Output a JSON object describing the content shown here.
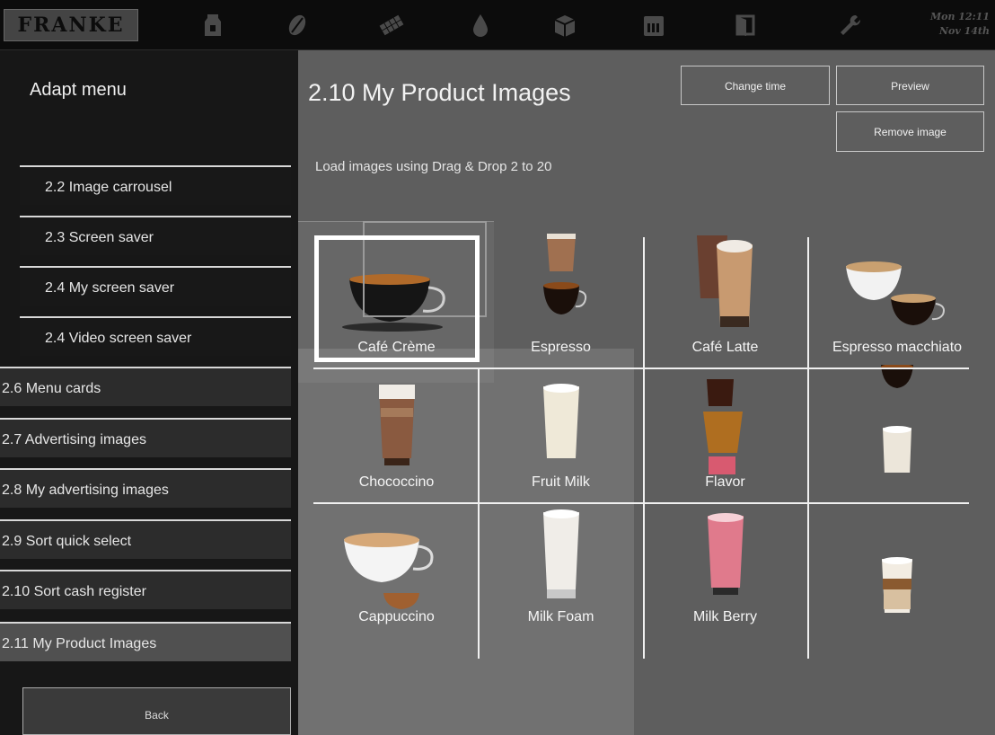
{
  "header": {
    "logo": "FRANKE",
    "icons": [
      "milk-carton-icon",
      "coffee-bean-icon",
      "chocolate-icon",
      "water-drop-icon",
      "box-icon",
      "brush-icon",
      "door-icon",
      "wrench-icon"
    ],
    "date_line1": "Mon 12:11",
    "date_line2": "Nov 14th"
  },
  "sidebar": {
    "title": "Adapt menu",
    "items": [
      {
        "label": "2.2 Image carrousel"
      },
      {
        "label": "2.3 Screen saver"
      },
      {
        "label": "2.4  My screen saver"
      },
      {
        "label": "2.4 Video screen saver"
      },
      {
        "label": "2.6 Menu cards"
      },
      {
        "label": "2.7 Advertising images"
      },
      {
        "label": "2.8 My advertising images"
      },
      {
        "label": "2.9 Sort quick select"
      },
      {
        "label": "2.10 Sort cash register"
      },
      {
        "label": "2.11 My Product Images"
      }
    ],
    "back_label": "Back"
  },
  "main": {
    "title": "2.10 My Product Images",
    "subtitle": "Load images using Drag & Drop 2 to 20",
    "buttons": {
      "change_time": "Change time",
      "preview": "Preview",
      "remove_image": "Remove image"
    },
    "products": [
      {
        "label": "Café Crème"
      },
      {
        "label": "Espresso"
      },
      {
        "label": "Café Latte"
      },
      {
        "label": "Espresso macchiato"
      },
      {
        "label": "Chococcino"
      },
      {
        "label": "Fruit Milk"
      },
      {
        "label": "Flavor"
      },
      {
        "label": ""
      },
      {
        "label": "Cappuccino"
      },
      {
        "label": "Milk Foam"
      },
      {
        "label": "Milk Berry"
      },
      {
        "label": ""
      }
    ]
  },
  "colors": {
    "background": "#5e5e5e",
    "sidebar": "#171717",
    "topbar": "#0c0c0c",
    "selection": "#ffffff"
  }
}
